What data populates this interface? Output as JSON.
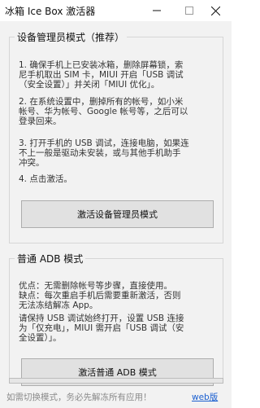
{
  "window": {
    "title": "冰箱 Ice Box 激活器",
    "controls": [
      "minimize-icon",
      "maximize-icon",
      "close-icon"
    ]
  },
  "device_admin": {
    "legend": "设备管理员模式（推荐）",
    "steps": [
      "1. 确保手机上已安装冰箱，删除屏幕锁，索\n尼手机取出 SIM 卡，MIUI 开启「USB 调试\n（安全设置）」并关闭「MIUI 优化」。",
      "2. 在系统设置中，删掉所有的帐号，如小米\n帐号、华为帐号、Google 帐号等，之后可以\n登录回来。",
      "3. 打开手机的 USB 调试，连接电脑，如果连\n不上一般是驱动未安装，或与其他手机助手\n冲突。",
      "4. 点击激活。"
    ],
    "button_label": "激活设备管理员模式"
  },
  "normal_adb": {
    "legend": "普通 ADB 模式",
    "pros_cons": "优点：无需删除帐号等步骤，直接使用。\n缺点：每次重启手机后需要重新激活，否则\n无法冻结解冻 App。",
    "instructions": "请保持 USB 调试始终打开，设置 USB 连接\n为「仅充电」，MIUI 需开启「USB 调试（安\n全设置）」。",
    "button_label": "激活普通 ADB 模式"
  },
  "progress": {
    "value": 0
  },
  "footer": {
    "notice": "如需切换模式，务必先解冻所有应用！",
    "link": "web版"
  }
}
